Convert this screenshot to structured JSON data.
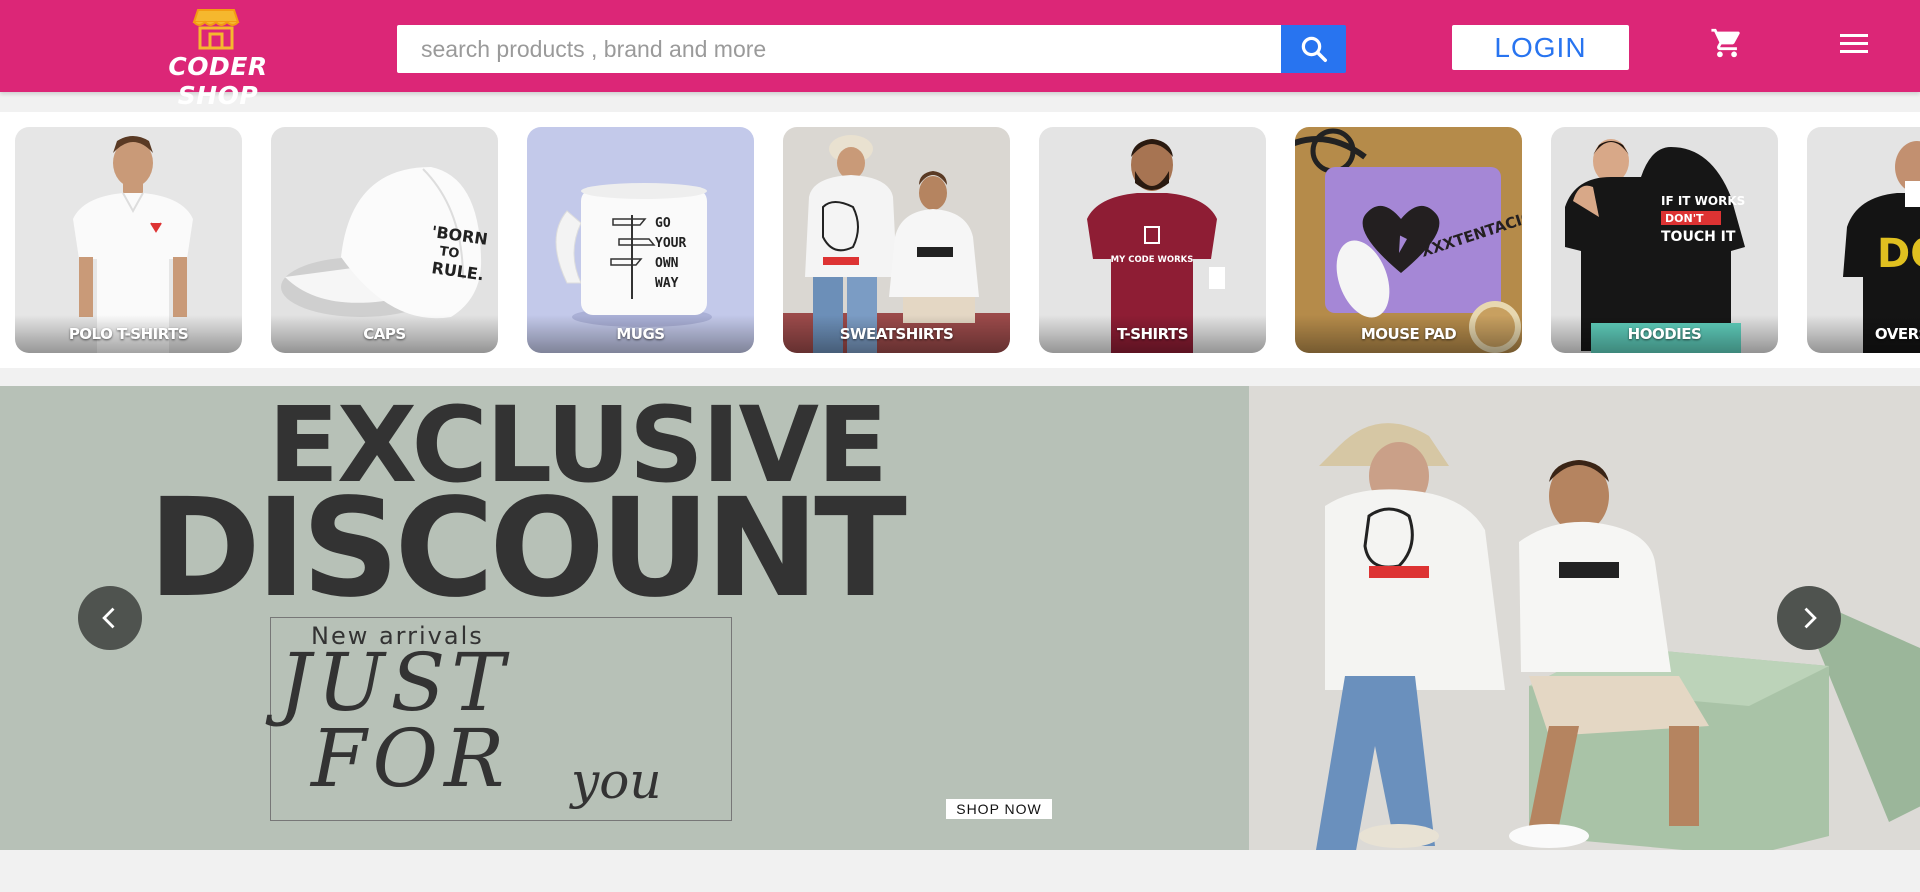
{
  "header": {
    "logo_text": "CODER SHOP",
    "search_placeholder": "search products , brand and more",
    "login_label": "LOGIN",
    "icons": [
      "store-icon",
      "search-icon",
      "cart-icon",
      "menu-icon"
    ],
    "colors": {
      "brand": "#dc2677",
      "accent": "#2874f0"
    }
  },
  "categories": [
    {
      "label": "POLO T-SHIRTS",
      "bg": "#e6e6e6",
      "product": "polo"
    },
    {
      "label": "CAPS",
      "bg": "#e2e2e2",
      "product": "cap"
    },
    {
      "label": "MUGS",
      "bg": "#c3c9ea",
      "product": "mug"
    },
    {
      "label": "SWEATSHIRTS",
      "bg": "#dad7d2",
      "product": "sweat"
    },
    {
      "label": "T-SHIRTS",
      "bg": "#e4e4e4",
      "product": "tshirt"
    },
    {
      "label": "MOUSE PAD",
      "bg": "#b58b4a",
      "product": "pad"
    },
    {
      "label": "HOODIES",
      "bg": "#e2e2e2",
      "product": "hoodie"
    },
    {
      "label": "OVERSIZED",
      "bg": "#e4e4e4",
      "product": "oversized"
    }
  ],
  "banner": {
    "line1": "EXCLUSIVE",
    "line2": "DISCOUNT",
    "new_arrivals": "New arrivals",
    "just": "JUST",
    "for": "FOR",
    "you": "you",
    "cta": "SHOP NOW",
    "colors": {
      "left_bg": "#b7c1b7",
      "right_bg": "#dcdad6",
      "text": "#333333"
    }
  }
}
